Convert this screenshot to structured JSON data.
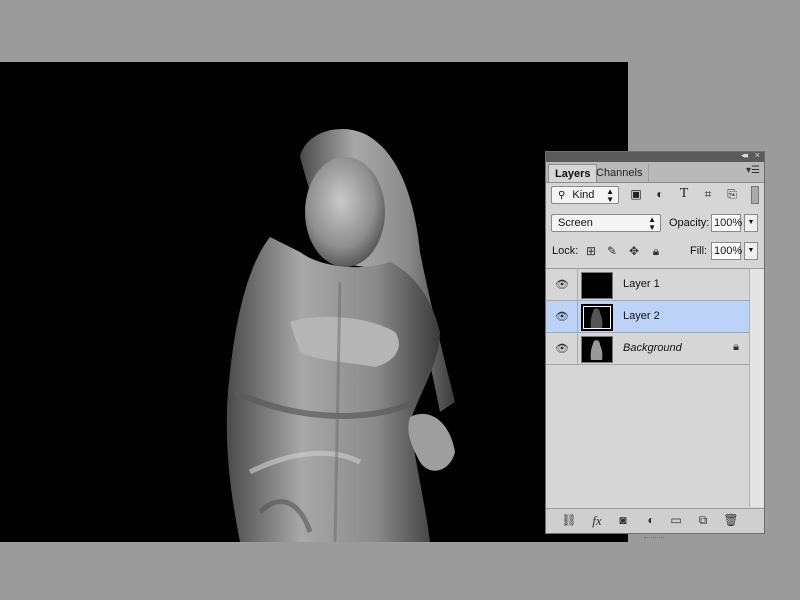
{
  "panel": {
    "tabs": [
      {
        "label": "Layers",
        "active": true
      },
      {
        "label": "Channels",
        "active": false
      }
    ],
    "filter": {
      "kind_label": "Kind",
      "icons": [
        "image-filter-icon",
        "adjustment-filter-icon",
        "type-filter-icon",
        "shape-filter-icon",
        "smart-object-filter-icon"
      ]
    },
    "blend_mode": "Screen",
    "opacity_label": "Opacity:",
    "opacity_value": "100%",
    "lock_label": "Lock:",
    "fill_label": "Fill:",
    "fill_value": "100%",
    "layers": [
      {
        "name": "Layer 1",
        "visible": true,
        "selected": false,
        "italic": false,
        "locked": false
      },
      {
        "name": "Layer 2",
        "visible": true,
        "selected": true,
        "italic": false,
        "locked": false
      },
      {
        "name": "Background",
        "visible": true,
        "selected": false,
        "italic": true,
        "locked": true
      }
    ],
    "footer_icons": [
      "link-layers-icon",
      "fx-icon",
      "add-mask-icon",
      "adjustment-layer-icon",
      "group-folder-icon",
      "new-layer-icon",
      "delete-layer-icon"
    ]
  },
  "colors": {
    "workspace": "#9b9b9b",
    "canvas": "#000000",
    "panel": "#d6d6d6",
    "selected_layer": "#bcd3f8"
  }
}
